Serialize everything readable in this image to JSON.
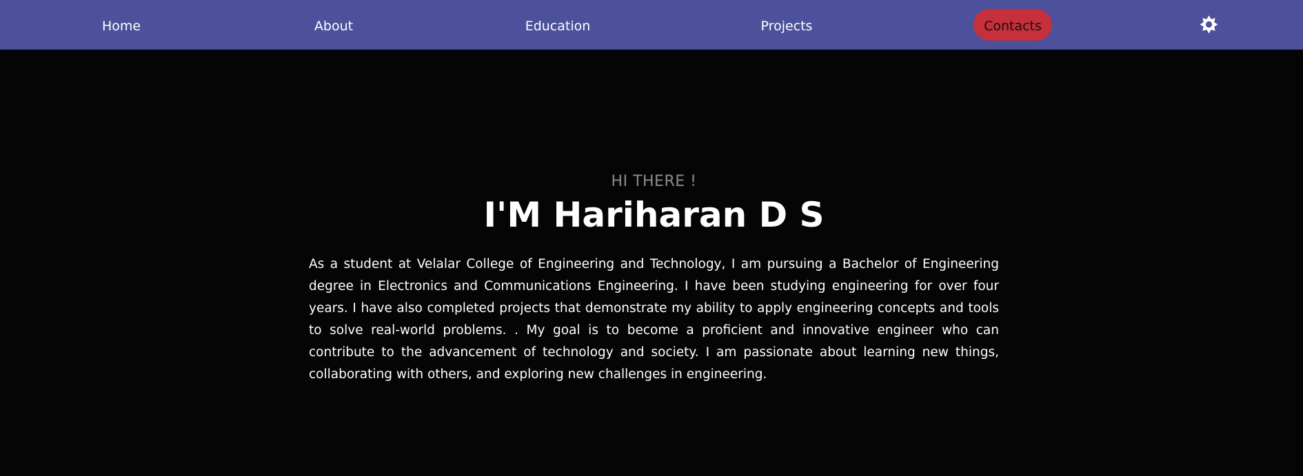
{
  "nav": {
    "home": "Home",
    "about": "About",
    "education": "Education",
    "projects": "Projects",
    "contacts": "Contacts",
    "theme_icon": "sun-icon"
  },
  "hero": {
    "greeting": "HI THERE !",
    "name": "I'M Hariharan D S",
    "intro": "As a student at Velalar College of Engineering and Technology, I am pursuing a Bachelor of Engineering degree in Electronics and Communications Engineering. I have been studying engineering for over four years. I have also completed projects that demonstrate my ability to apply engineering concepts and tools to solve real-world problems. . My goal is to become a proficient and innovative engineer who can contribute to the advancement of technology and society. I am passionate about learning new things, collaborating with others, and exploring new challenges in engineering."
  },
  "colors": {
    "navbar": "#4d519b",
    "contacts_button": "#c5303b",
    "background": "#050505",
    "greeting": "#8c8c8c"
  }
}
